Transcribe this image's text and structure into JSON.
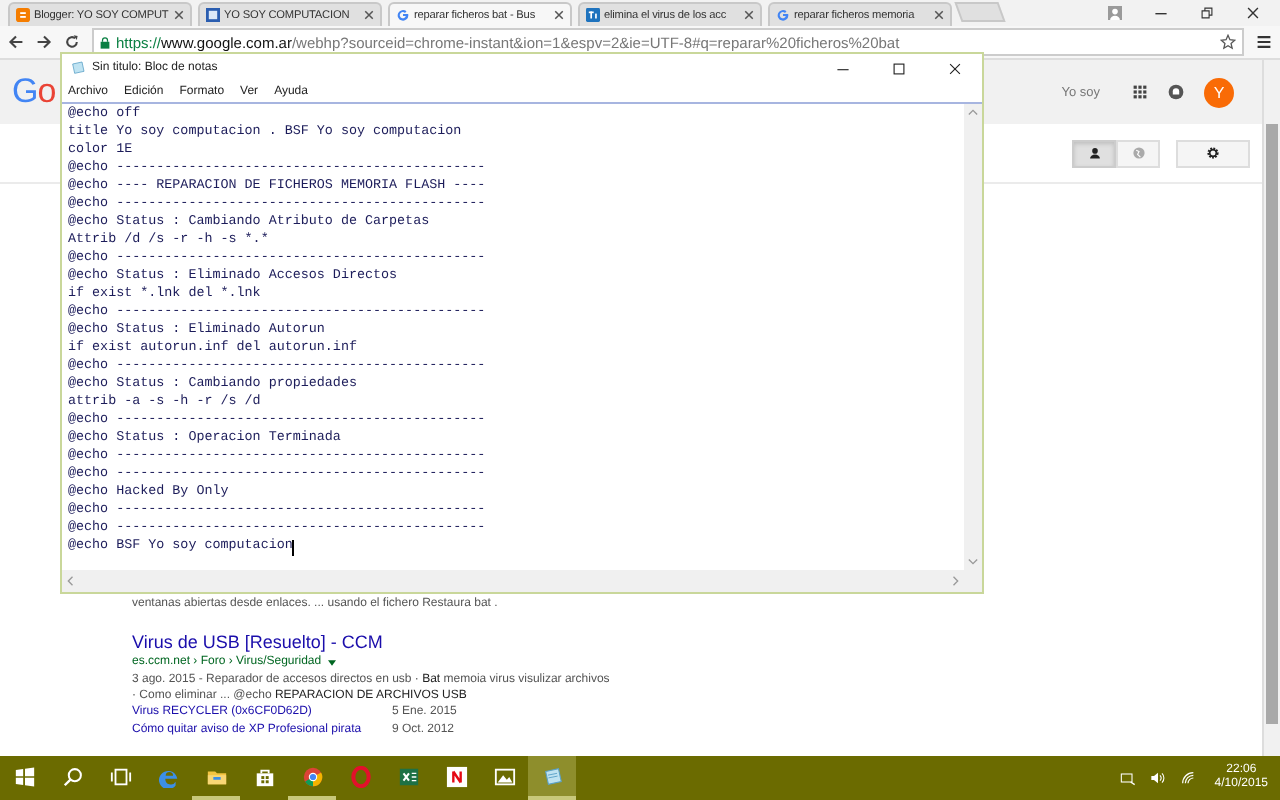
{
  "browser": {
    "tabs": [
      {
        "kind": "blogger",
        "title": "Blogger: YO SOY COMPUT",
        "selected": false
      },
      {
        "kind": "site",
        "title": "YO SOY COMPUTACION",
        "selected": false
      },
      {
        "kind": "google",
        "title": "reparar ficheros bat - Bus",
        "selected": true
      },
      {
        "kind": "ti",
        "title": "elimina el virus de los acc",
        "selected": false
      },
      {
        "kind": "google",
        "title": "reparar ficheros memoria",
        "selected": false
      }
    ],
    "address": {
      "scheme": "https://",
      "host": "www.google.com.ar",
      "path": "/webhp?sourceid=chrome-instant&ion=1&espv=2&ie=UTF-8#q=reparar%20ficheros%20bat"
    }
  },
  "google": {
    "logo": "Go",
    "user_name": "Yo soy",
    "avatar_letter": "Y",
    "search_types": [
      {
        "kind": "person",
        "selected": true
      },
      {
        "kind": "globe",
        "selected": false
      }
    ],
    "snippet_tail": "ventanas abiertas desde enlaces. ... usando el fichero Restaura bat .",
    "result": {
      "title": "Virus de USB [Resuelto] - CCM",
      "breadcrumb": "es.ccm.net › Foro › Virus/Seguridad",
      "snippet": "3 ago. 2015 - Reparador de accesos directos en usb · **Bat** memoia virus visulizar archivos · Como eliminar ... @echo **REPARACION DE ARCHIVOS USB**",
      "sublinks": [
        {
          "title": "Virus RECYCLER (0x6CF0D62D)",
          "date": "5 Ene. 2015"
        },
        {
          "title": "Cómo quitar aviso de XP Profesional pirata",
          "date": "9 Oct. 2012"
        }
      ]
    }
  },
  "notepad": {
    "title": "Sin titulo: Bloc de notas",
    "menu": [
      "Archivo",
      "Edición",
      "Formato",
      "Ver",
      "Ayuda"
    ],
    "lines": [
      "@echo off",
      "title Yo soy computacion . BSF Yo soy computacion",
      "color 1E",
      "@echo ----------------------------------------------",
      "@echo ---- REPARACION DE FICHEROS MEMORIA FLASH ----",
      "@echo ----------------------------------------------",
      "@echo Status : Cambiando Atributo de Carpetas",
      "Attrib /d /s -r -h -s *.*",
      "@echo ----------------------------------------------",
      "@echo Status : Eliminado Accesos Directos",
      "if exist *.lnk del *.lnk",
      "@echo ----------------------------------------------",
      "@echo Status : Eliminado Autorun",
      "if exist autorun.inf del autorun.inf",
      "@echo ----------------------------------------------",
      "@echo Status : Cambiando propiedades",
      "attrib -a -s -h -r /s /d",
      "@echo ----------------------------------------------",
      "@echo Status : Operacion Terminada",
      "@echo ----------------------------------------------",
      "@echo ----------------------------------------------",
      "@echo Hacked By Only",
      "@echo ----------------------------------------------",
      "@echo ----------------------------------------------",
      "@echo BSF Yo soy computacion"
    ]
  },
  "taskbar": {
    "apps": [
      {
        "kind": "start",
        "selected": false,
        "running": false
      },
      {
        "kind": "search",
        "selected": false,
        "running": false
      },
      {
        "kind": "taskview",
        "selected": false,
        "running": false
      },
      {
        "kind": "edge",
        "selected": false,
        "running": false
      },
      {
        "kind": "explorer",
        "selected": false,
        "running": true
      },
      {
        "kind": "store",
        "selected": false,
        "running": false
      },
      {
        "kind": "chrome",
        "selected": false,
        "running": true
      },
      {
        "kind": "opera",
        "selected": false,
        "running": false
      },
      {
        "kind": "excel",
        "selected": false,
        "running": false
      },
      {
        "kind": "netflix",
        "selected": false,
        "running": false
      },
      {
        "kind": "photos",
        "selected": false,
        "running": false
      },
      {
        "kind": "notepad",
        "selected": true,
        "running": true
      }
    ],
    "time": "22:06",
    "date": "4/10/2015"
  }
}
